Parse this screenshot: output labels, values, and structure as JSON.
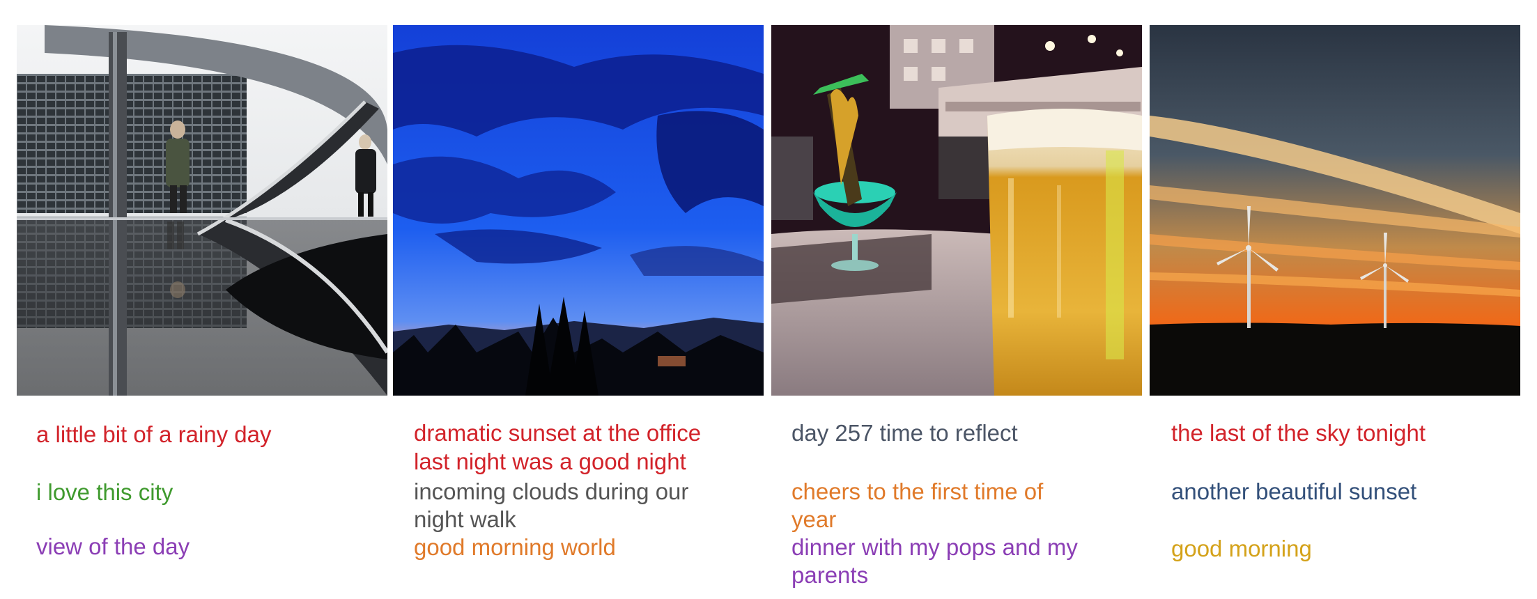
{
  "panels": [
    {
      "photo_subject": "modern building curve with reflection",
      "captions": [
        {
          "text": "a little bit of a rainy day",
          "color": "#d2232a"
        },
        {
          "text": "i love this city",
          "color": "#3f9a2e"
        },
        {
          "text": "view of the day",
          "color": "#8b3eb5"
        }
      ]
    },
    {
      "photo_subject": "blue dramatic sky over treeline",
      "captions": [
        {
          "text": "dramatic sunset at the office",
          "color": "#d2232a"
        },
        {
          "text": "last night was a good night",
          "color": "#d2232a"
        },
        {
          "text": "incoming clouds during our",
          "color": "#555555"
        },
        {
          "text": "night walk",
          "color": "#555555"
        },
        {
          "text": "good morning world",
          "color": "#e07a2a"
        }
      ]
    },
    {
      "photo_subject": "cocktail and glass of beer",
      "captions": [
        {
          "text": "day 257 time to reflect",
          "color": "#4b5566"
        },
        {
          "text": "cheers to the first time of",
          "color": "#e07a2a"
        },
        {
          "text": "year",
          "color": "#e07a2a"
        },
        {
          "text": "dinner with my pops and my",
          "color": "#8b3eb5"
        },
        {
          "text": "parents",
          "color": "#8b3eb5"
        }
      ]
    },
    {
      "photo_subject": "sunset sky with wind turbines",
      "captions": [
        {
          "text": "the last of the sky tonight",
          "color": "#d2232a"
        },
        {
          "text": "another beautiful sunset",
          "color": "#33507a"
        },
        {
          "text": "good morning",
          "color": "#d4a21a"
        }
      ]
    }
  ]
}
